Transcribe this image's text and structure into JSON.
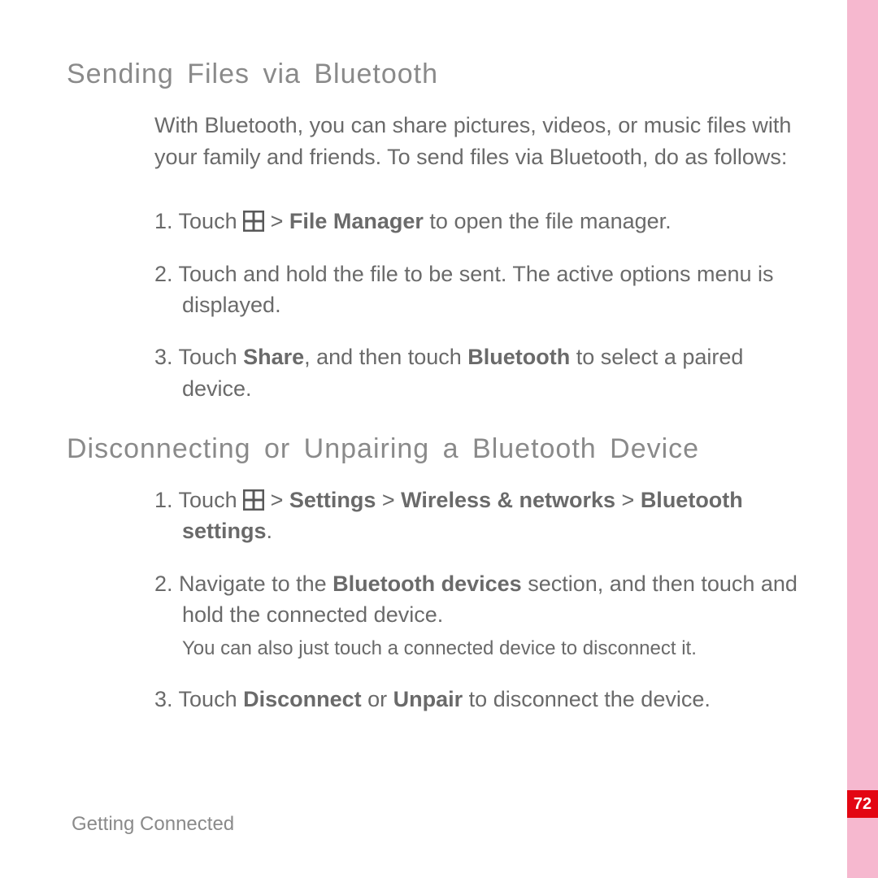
{
  "page_number": "72",
  "footer": "Getting Connected",
  "section1": {
    "heading": "Sending Files via Bluetooth",
    "intro": "With Bluetooth, you can share pictures, videos, or music files with your family and friends. To send files via Bluetooth, do as follows:",
    "step1_prefix": "1. Touch ",
    "step1_sep": " > ",
    "step1_bold1": "File Manager",
    "step1_suffix": " to open the file manager.",
    "step2": "2. Touch and hold the file to be sent. The active options menu is displayed.",
    "step3_a": "3. Touch ",
    "step3_b": "Share",
    "step3_c": ", and then touch ",
    "step3_d": "Bluetooth",
    "step3_e": " to select a paired device."
  },
  "section2": {
    "heading": "Disconnecting or Unpairing a Bluetooth Device",
    "step1_prefix": "1. Touch ",
    "step1_sep1": " > ",
    "step1_b1": "Settings",
    "step1_sep2": " > ",
    "step1_b2": "Wireless & networks",
    "step1_sep3": " > ",
    "step1_b3": "Bluetooth settings",
    "step1_suffix": ".",
    "step2_a": "2. Navigate to the ",
    "step2_b": "Bluetooth devices",
    "step2_c": " section, and then touch and hold the connected device.",
    "step2_note": "You can also just touch a connected device to disconnect it.",
    "step3_a": "3. Touch ",
    "step3_b": "Disconnect",
    "step3_c": " or ",
    "step3_d": "Unpair",
    "step3_e": " to disconnect the device."
  }
}
